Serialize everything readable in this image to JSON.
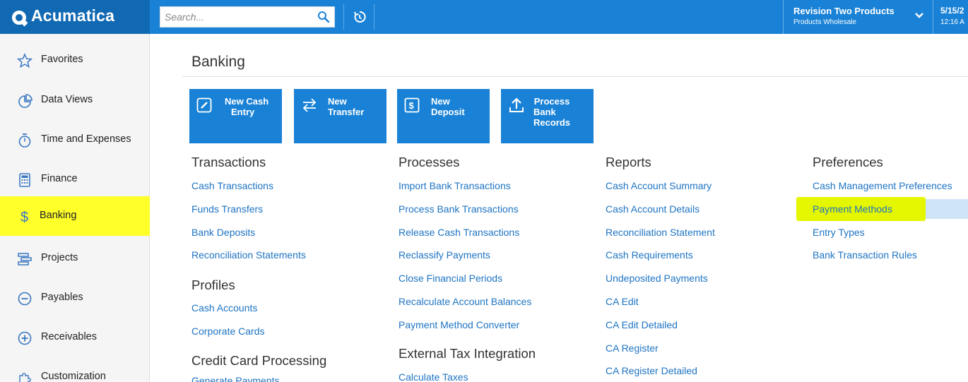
{
  "app": {
    "logo_text": "Acumatica",
    "brand_color": "#1a82d6",
    "highlight_color": "#ffff2a"
  },
  "topbar": {
    "search_placeholder": "Search...",
    "company_name": "Revision Two Products",
    "company_branch": "Products Wholesale",
    "date": "5/15/2",
    "time": "12:16 A"
  },
  "sidebar": {
    "items": [
      {
        "label": "Favorites",
        "icon": "star-icon"
      },
      {
        "label": "Data Views",
        "icon": "pie-chart-icon"
      },
      {
        "label": "Time and Expenses",
        "icon": "stopwatch-icon"
      },
      {
        "label": "Finance",
        "icon": "calculator-icon"
      },
      {
        "label": "Banking",
        "icon": "dollar-icon",
        "active": true
      },
      {
        "label": "Projects",
        "icon": "projects-icon"
      },
      {
        "label": "Payables",
        "icon": "minus-circle-icon"
      },
      {
        "label": "Receivables",
        "icon": "plus-circle-icon"
      },
      {
        "label": "Customization",
        "icon": "puzzle-icon"
      }
    ]
  },
  "main": {
    "title": "Banking",
    "tiles": [
      {
        "label": "New Cash Entry",
        "lines": [
          "New Cash",
          "Entry"
        ],
        "icon": "pencil-icon"
      },
      {
        "label": "New Transfer",
        "lines": [
          "New",
          "Transfer"
        ],
        "icon": "transfer-arrows-icon"
      },
      {
        "label": "New Deposit",
        "lines": [
          "New",
          "Deposit"
        ],
        "icon": "deposit-icon"
      },
      {
        "label": "Process Bank Records",
        "lines": [
          "Process",
          "Bank",
          "Records"
        ],
        "icon": "upload-icon"
      }
    ],
    "columns": {
      "transactions": {
        "heading": "Transactions",
        "links": [
          "Cash Transactions",
          "Funds Transfers",
          "Bank Deposits",
          "Reconciliation Statements"
        ]
      },
      "profiles": {
        "heading": "Profiles",
        "links": [
          "Cash Accounts",
          "Corporate Cards"
        ]
      },
      "credit_card": {
        "heading": "Credit Card Processing",
        "links": [
          "Generate Payments"
        ]
      },
      "processes": {
        "heading": "Processes",
        "links": [
          "Import Bank Transactions",
          "Process Bank Transactions",
          "Release Cash Transactions",
          "Reclassify Payments",
          "Close Financial Periods",
          "Recalculate Account Balances",
          "Payment Method Converter"
        ]
      },
      "external_tax": {
        "heading": "External Tax Integration",
        "links": [
          "Calculate Taxes"
        ]
      },
      "reports": {
        "heading": "Reports",
        "links": [
          "Cash Account Summary",
          "Cash Account Details",
          "Reconciliation Statement",
          "Cash Requirements",
          "Undeposited Payments",
          "CA Edit",
          "CA Edit Detailed",
          "CA Register",
          "CA Register Detailed"
        ]
      },
      "preferences": {
        "heading": "Preferences",
        "links": [
          "Cash Management Preferences",
          "Payment Methods",
          "Entry Types",
          "Bank Transaction Rules"
        ]
      }
    }
  }
}
